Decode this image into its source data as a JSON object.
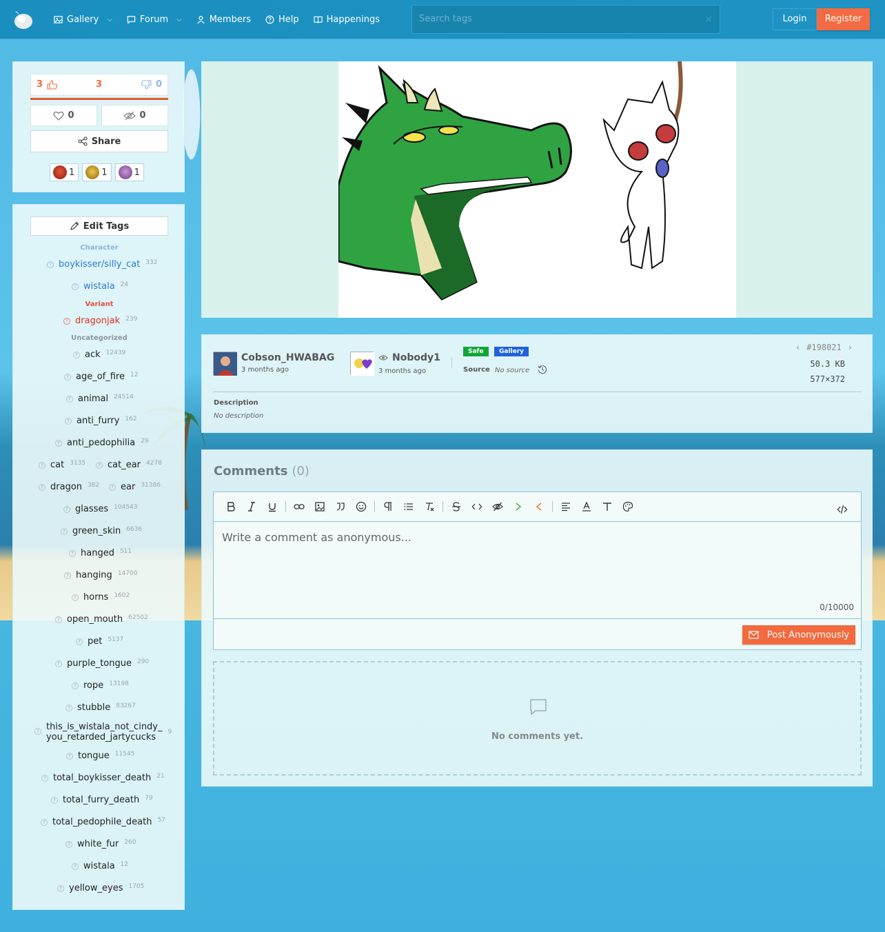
{
  "header": {
    "nav": [
      {
        "label": "Gallery",
        "icon": "image-icon",
        "dropdown": true
      },
      {
        "label": "Forum",
        "icon": "chat-icon",
        "dropdown": true
      },
      {
        "label": "Members",
        "icon": "user-icon",
        "dropdown": false
      },
      {
        "label": "Help",
        "icon": "help-icon",
        "dropdown": false
      },
      {
        "label": "Happenings",
        "icon": "book-icon",
        "dropdown": false
      }
    ],
    "search_placeholder": "Search tags",
    "login_label": "Login",
    "register_label": "Register"
  },
  "votes": {
    "up": "3",
    "score": "3",
    "down": "0",
    "favorites": "0",
    "hidden": "0",
    "share_label": "Share",
    "reactions": [
      {
        "count": "1",
        "color": "#c8321e"
      },
      {
        "count": "1",
        "color": "#d4a11c"
      },
      {
        "count": "1",
        "color": "#9b6bb8"
      }
    ]
  },
  "tags": {
    "edit_label": "Edit Tags",
    "categories": {
      "character": "Character",
      "variant": "Variant",
      "uncategorized": "Uncategorized"
    },
    "character": [
      {
        "name": "boykisser/silly_cat",
        "count": "332"
      },
      {
        "name": "wistala",
        "count": "24"
      }
    ],
    "variant": [
      {
        "name": "dragonjak",
        "count": "239"
      }
    ],
    "uncategorized": [
      {
        "name": "ack",
        "count": "12439"
      },
      {
        "name": "age_of_fire",
        "count": "12"
      },
      {
        "name": "animal",
        "count": "24514"
      },
      {
        "name": "anti_furry",
        "count": "162"
      },
      {
        "name": "anti_pedophilia",
        "count": "29"
      },
      {
        "name": "cat",
        "count": "3135"
      },
      {
        "name": "cat_ear",
        "count": "4278"
      },
      {
        "name": "dragon",
        "count": "382"
      },
      {
        "name": "ear",
        "count": "31386"
      },
      {
        "name": "glasses",
        "count": "104543"
      },
      {
        "name": "green_skin",
        "count": "6636"
      },
      {
        "name": "hanged",
        "count": "511"
      },
      {
        "name": "hanging",
        "count": "14700"
      },
      {
        "name": "horns",
        "count": "1602"
      },
      {
        "name": "open_mouth",
        "count": "62502"
      },
      {
        "name": "pet",
        "count": "5137"
      },
      {
        "name": "purple_tongue",
        "count": "290"
      },
      {
        "name": "rope",
        "count": "13198"
      },
      {
        "name": "stubble",
        "count": "83267"
      },
      {
        "name": "this_is_wistala_not_cindy_",
        "name2": "you_retarded_jartycucks",
        "count": "9"
      },
      {
        "name": "tongue",
        "count": "11545"
      },
      {
        "name": "total_boykisser_death",
        "count": "21"
      },
      {
        "name": "total_furry_death",
        "count": "79"
      },
      {
        "name": "total_pedophile_death",
        "count": "57"
      },
      {
        "name": "white_fur",
        "count": "260"
      },
      {
        "name": "wistala",
        "count": "12"
      },
      {
        "name": "yellow_eyes",
        "count": "1705"
      }
    ]
  },
  "post": {
    "uploader": "Cobson_HWABAG",
    "uploader_time": "3 months ago",
    "approver": "Nobody1",
    "approver_time": "3 months ago",
    "rating": "Safe",
    "board": "Gallery",
    "source_label": "Source",
    "source_value": "No source",
    "post_id": "#198021",
    "file_size": "50.3 KB",
    "dimensions": "577×372",
    "description_label": "Description",
    "description_value": "No description"
  },
  "comments": {
    "title": "Comments",
    "count": "(0)",
    "placeholder": "Write a comment as anonymous...",
    "char_counter": "0/10000",
    "post_label": "Post Anonymously",
    "empty_text": "No comments yet."
  },
  "colors": {
    "accent": "#f36b42",
    "header": "#1a8fbf",
    "safe": "#12a63a",
    "gallery": "#1f62e0"
  }
}
